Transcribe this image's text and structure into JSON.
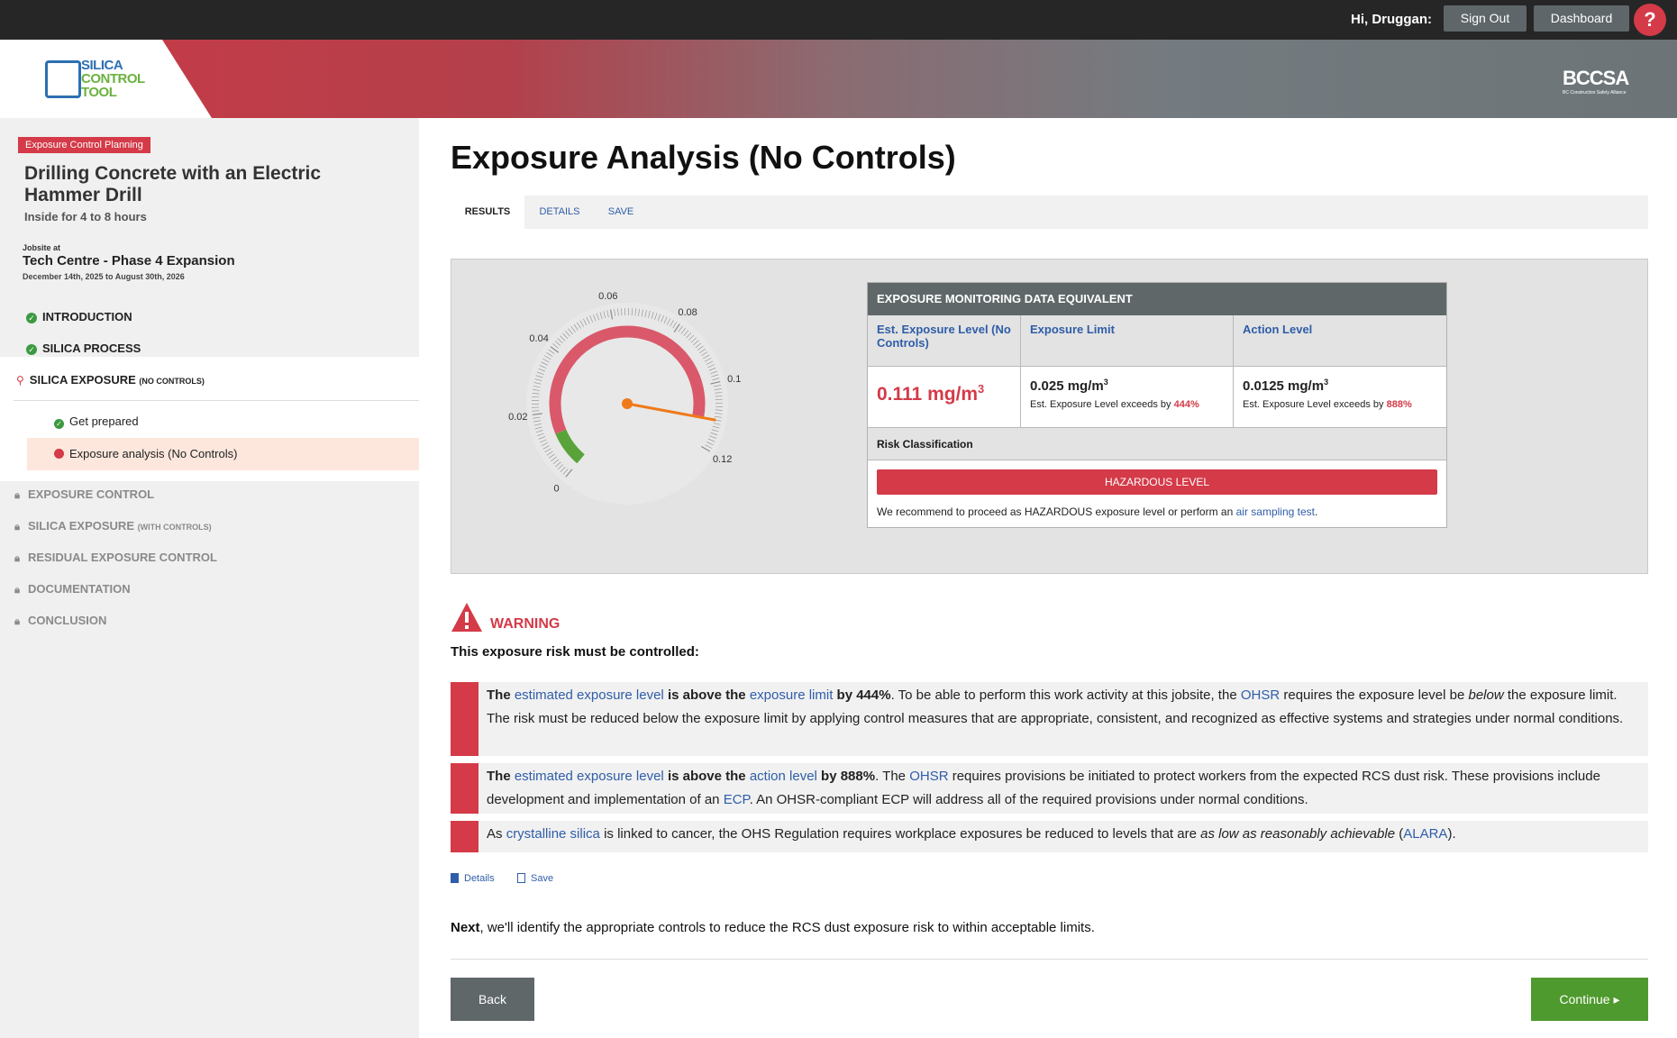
{
  "topbar": {
    "greeting": "Hi, Druggan:",
    "signout": "Sign Out",
    "dashboard": "Dashboard",
    "help": "?"
  },
  "banner": {
    "logo_line1": "SILICA",
    "logo_line2": "CONTROL",
    "logo_line3": "TOOL",
    "partner": "BCCSA",
    "partner_sub": "BC Construction Safety Alliance"
  },
  "sidebar": {
    "tag": "Exposure Control Planning",
    "title": "Drilling Concrete with an Electric Hammer Drill",
    "subtitle": "Inside for 4 to 8 hours",
    "jobsite_label": "Jobsite at",
    "jobsite": "Tech Centre - Phase 4 Expansion",
    "dates": "December 14th, 2025 to August 30th, 2026",
    "nav": {
      "intro": "INTRODUCTION",
      "process": "SILICA PROCESS",
      "exposure": "SILICA EXPOSURE",
      "exposure_small": "(NO CONTROLS)",
      "sub1": "Get prepared",
      "sub2": "Exposure analysis (No Controls)",
      "control": "EXPOSURE CONTROL",
      "exposure_wc": "SILICA EXPOSURE",
      "exposure_wc_small": "(WITH CONTROLS)",
      "residual": "RESIDUAL EXPOSURE CONTROL",
      "docs": "DOCUMENTATION",
      "conclusion": "CONCLUSION"
    }
  },
  "main": {
    "title": "Exposure Analysis (No Controls)",
    "tabs": [
      "RESULTS",
      "DETAILS",
      "SAVE"
    ]
  },
  "gauge": {
    "min": 0,
    "max": 0.12,
    "value": 0.111,
    "labels": [
      "0",
      "0.02",
      "0.04",
      "0.06",
      "0.08",
      "0.1",
      "0.12"
    ],
    "green_end": 0.0125,
    "colors": {
      "green": "#5aa33a",
      "red": "#d9596a",
      "needle": "#f07a1a"
    }
  },
  "emd": {
    "header": "EXPOSURE MONITORING DATA EQUIVALENT",
    "col1": "Est. Exposure Level (No Controls)",
    "col2": "Exposure Limit",
    "col3": "Action Level",
    "val1": "0.111 mg/m",
    "val2": "0.025 mg/m",
    "val3": "0.0125 mg/m",
    "unit_sup": "3",
    "note_prefix": "Est. Exposure Level exceeds by",
    "note2_pct": "444%",
    "note3_pct": "888%",
    "risk_header": "Risk Classification",
    "risk_level": "HAZARDOUS LEVEL",
    "rec_text": "We recommend to proceed as HAZARDOUS exposure level or perform an",
    "rec_link": "air sampling test",
    "rec_end": "."
  },
  "warning": {
    "title": "WARNING",
    "subtitle": "This exposure risk must be controlled:",
    "r1": {
      "the": "The",
      "link1": "estimated exposure level",
      "mid": "is above the",
      "link2": "exposure limit",
      "by": "by 444%",
      "t1": ". To be able to perform this work activity at this jobsite, the",
      "ohsr": "OHSR",
      "t2": "requires the exposure level be",
      "below": "below",
      "t3": "the exposure limit. The risk must be reduced below the exposure limit by applying control measures that are appropriate, consistent, and recognized as effective systems and strategies under normal conditions."
    },
    "r2": {
      "the": "The",
      "link1": "estimated exposure level",
      "mid": "is above the",
      "link2": "action level",
      "by": "by 888%",
      "t1": ". The",
      "ohsr": "OHSR",
      "t2": "requires provisions be initiated to protect workers from the expected RCS dust risk. These provisions include development and implementation of an",
      "ecp": "ECP",
      "t3": ". An OHSR-compliant ECP will address all of the required provisions under normal conditions."
    },
    "r3": {
      "t1": "As",
      "link": "crystalline silica",
      "t2": "is linked to cancer, the OHS Regulation requires workplace exposures be reduced to levels that are",
      "ital": "as low as reasonably achievable",
      "open": "(",
      "alara": "ALARA",
      "close": ")."
    }
  },
  "footer": {
    "details": "Details",
    "save": "Save",
    "next_bold": "Next",
    "next_text": ", we'll identify the appropriate controls to reduce the RCS dust exposure risk to within acceptable limits.",
    "back": "Back",
    "continue": "Continue ▸"
  }
}
